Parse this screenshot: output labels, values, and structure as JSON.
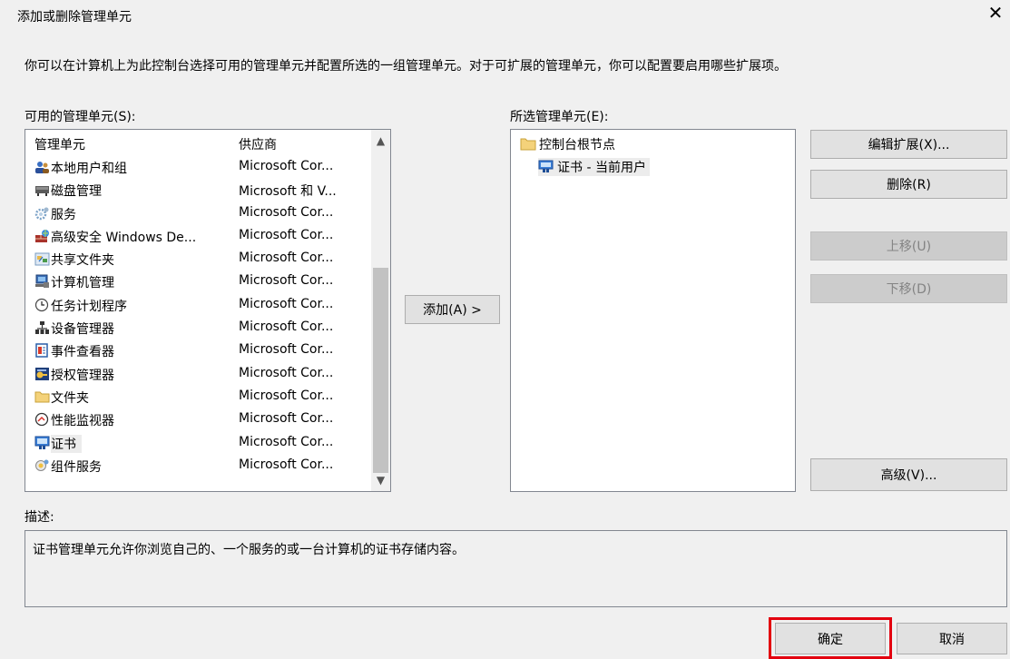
{
  "dialog": {
    "title": "添加或删除管理单元",
    "close_symbol": "✕",
    "intro": "你可以在计算机上为此控制台选择可用的管理单元并配置所选的一组管理单元。对于可扩展的管理单元，你可以配置要启用哪些扩展项。"
  },
  "available": {
    "label": "可用的管理单元(S):",
    "col_snapin": "管理单元",
    "col_vendor": "供应商",
    "items": [
      {
        "name": "本地用户和组",
        "vendor": "Microsoft Cor...",
        "icon": "users-icon"
      },
      {
        "name": "磁盘管理",
        "vendor": "Microsoft 和 V...",
        "icon": "disk-icon"
      },
      {
        "name": "服务",
        "vendor": "Microsoft Cor...",
        "icon": "services-gear-icon"
      },
      {
        "name": "高级安全 Windows De...",
        "vendor": "Microsoft Cor...",
        "icon": "firewall-icon"
      },
      {
        "name": "共享文件夹",
        "vendor": "Microsoft Cor...",
        "icon": "shared-folder-icon"
      },
      {
        "name": "计算机管理",
        "vendor": "Microsoft Cor...",
        "icon": "computer-management-icon"
      },
      {
        "name": "任务计划程序",
        "vendor": "Microsoft Cor...",
        "icon": "clock-icon"
      },
      {
        "name": "设备管理器",
        "vendor": "Microsoft Cor...",
        "icon": "device-manager-icon"
      },
      {
        "name": "事件查看器",
        "vendor": "Microsoft Cor...",
        "icon": "event-viewer-icon"
      },
      {
        "name": "授权管理器",
        "vendor": "Microsoft Cor...",
        "icon": "authorization-icon"
      },
      {
        "name": "文件夹",
        "vendor": "Microsoft Cor...",
        "icon": "folder-icon"
      },
      {
        "name": "性能监视器",
        "vendor": "Microsoft Cor...",
        "icon": "performance-icon"
      },
      {
        "name": "证书",
        "vendor": "Microsoft Cor...",
        "icon": "certificate-icon",
        "selected": true
      },
      {
        "name": "组件服务",
        "vendor": "Microsoft Cor...",
        "icon": "component-services-icon"
      }
    ]
  },
  "add_button": "添加(A) >",
  "selected": {
    "label": "所选管理单元(E):",
    "root": "控制台根节点",
    "child": "证书 - 当前用户"
  },
  "actions": {
    "edit_extensions": "编辑扩展(X)...",
    "remove": "删除(R)",
    "move_up": "上移(U)",
    "move_down": "下移(D)",
    "advanced": "高级(V)..."
  },
  "description": {
    "label": "描述:",
    "text": "证书管理单元允许你浏览自己的、一个服务的或一台计算机的证书存储内容。"
  },
  "footer": {
    "ok": "确定",
    "cancel": "取消"
  },
  "colors": {
    "highlight": "#e3000f",
    "dialog_bg": "#f0f0f0",
    "button_bg": "#e1e1e1"
  }
}
